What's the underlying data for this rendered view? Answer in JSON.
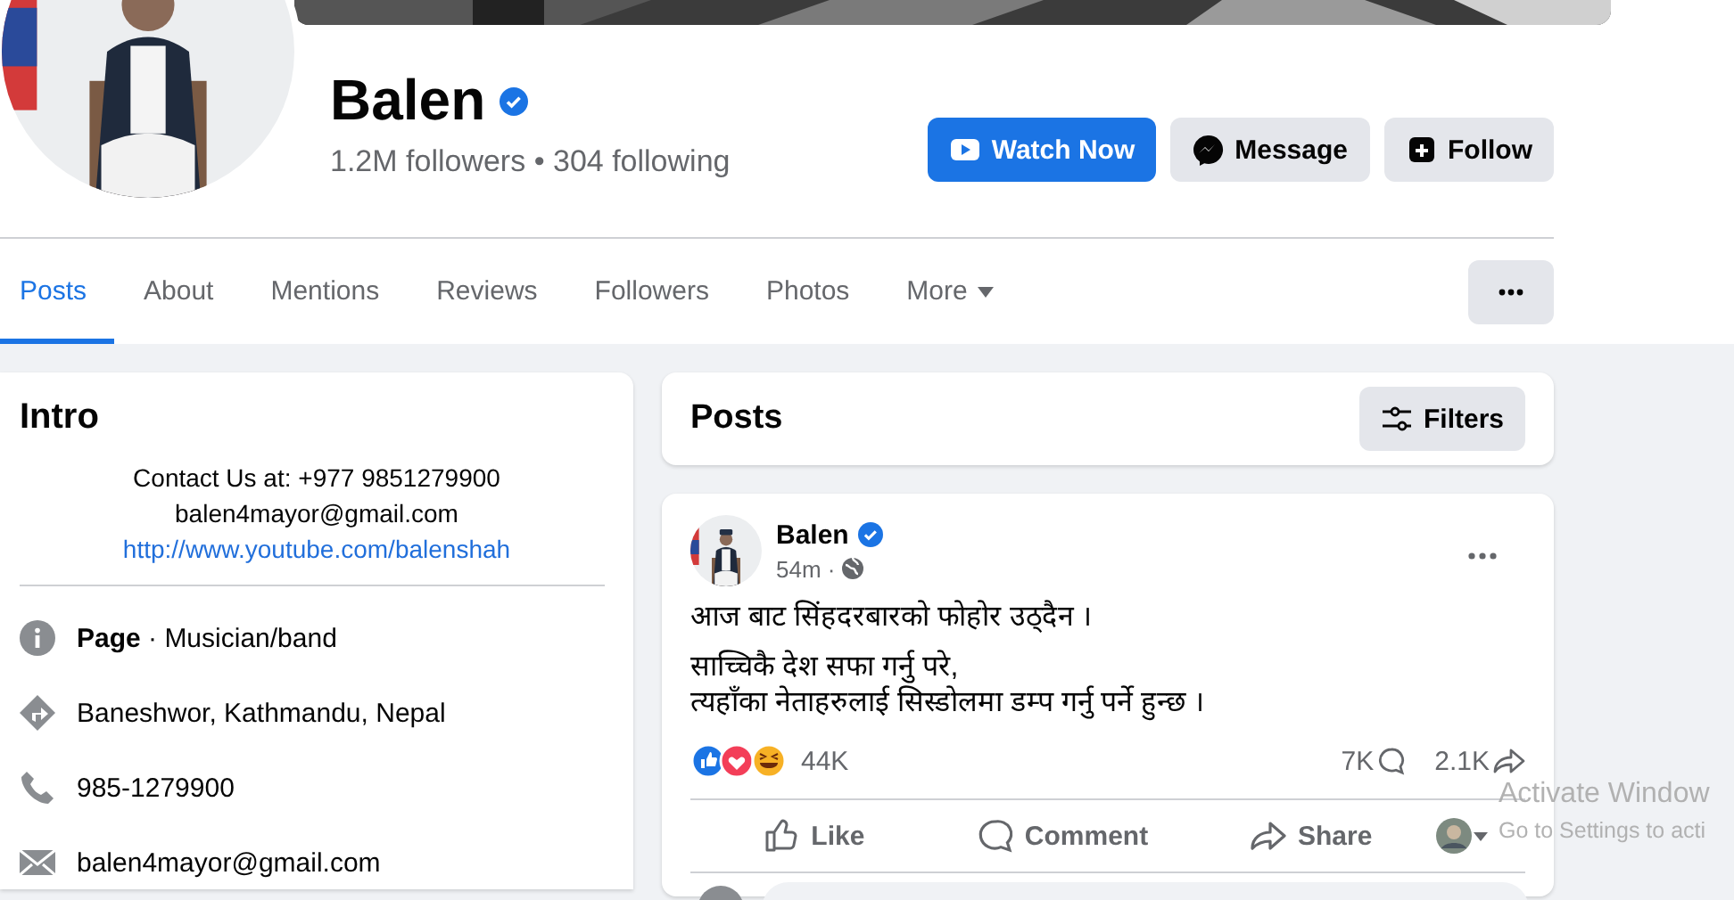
{
  "cover": {
    "kind": "picture"
  },
  "profile": {
    "name": "Balen",
    "verified": true,
    "stats": "1.2M followers • 304 following"
  },
  "actions": [
    {
      "label": "Watch Now",
      "kind": "watch"
    },
    {
      "label": "Message",
      "kind": "message"
    },
    {
      "label": "Follow",
      "kind": "follow"
    }
  ],
  "tabs": [
    {
      "label": "Posts",
      "selected": true,
      "dropdown": false
    },
    {
      "label": "About",
      "selected": false,
      "dropdown": false
    },
    {
      "label": "Mentions",
      "selected": false,
      "dropdown": false
    },
    {
      "label": "Reviews",
      "selected": false,
      "dropdown": false
    },
    {
      "label": "Followers",
      "selected": false,
      "dropdown": false
    },
    {
      "label": "Photos",
      "selected": false,
      "dropdown": false
    },
    {
      "label": "More",
      "selected": false,
      "dropdown": true
    }
  ],
  "intro": {
    "title": "Intro",
    "bio": [
      "Contact Us at: +977 9851279900",
      "balen4mayor@gmail.com"
    ],
    "link": "http://www.youtube.com/balenshah",
    "details": [
      {
        "kind": "info",
        "text": "**Page** · Musician/band"
      },
      {
        "kind": "address",
        "text": "Baneshwor, Kathmandu, Nepal"
      },
      {
        "kind": "phone",
        "text": "985-1279900"
      },
      {
        "kind": "email",
        "text": "balen4mayor@gmail.com"
      }
    ]
  },
  "posts_header": {
    "title": "Posts",
    "filter": "Filters"
  },
  "post": {
    "author": "Balen",
    "verified": true,
    "time": "54m ·",
    "paragraphs": [
      [
        "आज बाट सिंहदरबारको फोहोर उठ्दैन ।"
      ],
      [
        "साच्चिकै देश सफा गर्नु परे,",
        "त्यहाँका नेताहरुलाई सिस्डोलमा डम्प गर्नु पर्ने हुन्छ ।"
      ]
    ],
    "reactions": "44K",
    "comments": "7K",
    "shares": "2.1K",
    "buttons": [
      {
        "label": "Like",
        "kind": "like"
      },
      {
        "label": "Comment",
        "kind": "comment"
      },
      {
        "label": "Share",
        "kind": "share"
      }
    ]
  },
  "overlay": [
    "Activate Window",
    "Go to Settings to acti"
  ]
}
